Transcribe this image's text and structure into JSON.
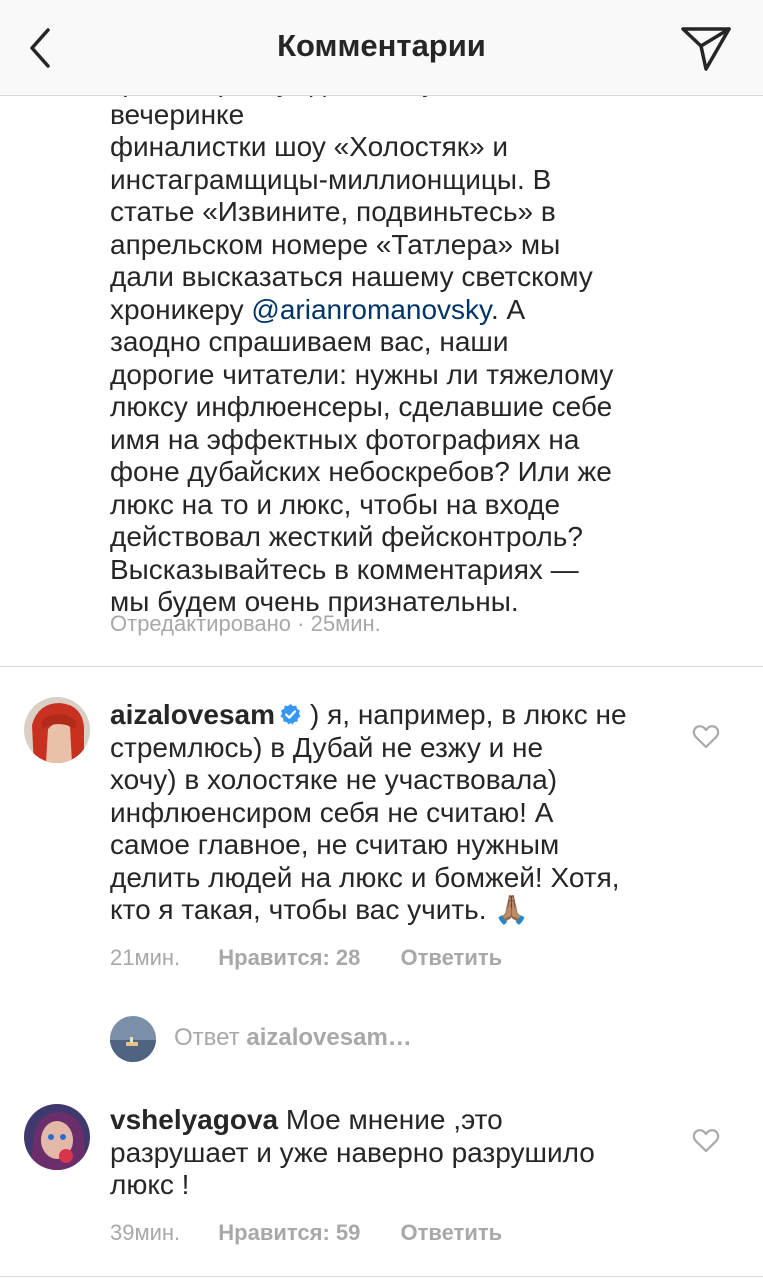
{
  "header": {
    "title": "Комментарии",
    "back_icon": "chevron-left-icon",
    "share_icon": "paper-plane-icon"
  },
  "caption": {
    "line_partial": "критики рассуждают об участии в вечеринке",
    "text_before_mention": "финалистки шоу «Холостяк» и\nинстаграмщицы-миллионщицы. В\nстатье «Извините, подвиньтесь» в\nапрельском номере «Татлера» мы\nдали высказаться нашему светскому\nхроникеру ",
    "mention": "@arianromanovsky",
    "text_after_mention": ". А\nзаодно спрашиваем вас, наши\nдорогие читатели: нужны ли тяжелому\nлюксу инфлюенсеры, сделавшие себе\nимя на эффектных фотографиях на\nфоне дубайских небоскребов? Или же\nлюкс на то и люкс, чтобы на входе\nдействовал жесткий фейсконтроль?\nВысказывайтесь в комментариях —\nмы будем очень признательны.",
    "edited": "Отредактировано",
    "separator": " · ",
    "time": "25мин."
  },
  "comments": [
    {
      "username": "aizalovesam",
      "verified": true,
      "text": ") я, например, в люкс не\nстремлюсь) в Дубай не езжу и не\nхочу) в холостяке не участвовала)\nинфлюенсиром себя не считаю! А\nсамое главное, не считаю нужным\nделить людей на люкс и бомжей! Хотя,\nкто я такая, чтобы вас учить. ",
      "emoji": "🙏🏽",
      "time": "21мин.",
      "likes": "Нравится: 28",
      "reply": "Ответить",
      "reply_prompt": "Ответ",
      "reply_to": "aizalovesam…"
    },
    {
      "username": "vshelyagova",
      "text": "Мое мнение ,это\nразрушает и уже наверно разрушило\nлюкс !",
      "time": "39мин.",
      "likes": "Нравится: 59",
      "reply": "Ответить"
    }
  ],
  "colors": {
    "text": "#262626",
    "muted": "#a8a8a8",
    "mention": "#003569",
    "verified": "#3897f0",
    "divider": "#dbdbdb"
  }
}
